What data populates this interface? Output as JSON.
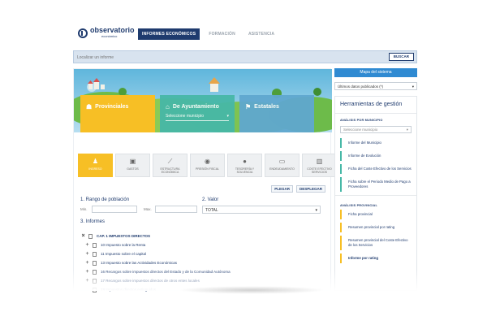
{
  "header": {
    "logo_title": "observatorio",
    "logo_sub": "económico",
    "nav": [
      {
        "label": "INFORMES ECONÓMICOS",
        "active": true
      },
      {
        "label": "FORMACIÓN",
        "active": false
      },
      {
        "label": "ASISTENCIA",
        "active": false
      }
    ]
  },
  "search": {
    "placeholder": "Localizar un informe",
    "button": "BUSCAR"
  },
  "tiles": [
    {
      "title": "Provinciales",
      "icon": "people-icon",
      "select": ""
    },
    {
      "title": "De Ayuntamiento",
      "icon": "bank-icon",
      "select": "Seleccione municipio"
    },
    {
      "title": "Estatales",
      "icon": "flag-icon",
      "select": ""
    }
  ],
  "categories": [
    {
      "label": "INGRESO",
      "icon": "person-icon",
      "active": true
    },
    {
      "label": "GASTOS",
      "icon": "gift-icon",
      "active": false
    },
    {
      "label": "ESTRUCTURA ECONÓMICA",
      "icon": "chart-line-icon",
      "active": false
    },
    {
      "label": "PRESIÓN FISCAL",
      "icon": "gauge-icon",
      "active": false
    },
    {
      "label": "TESORERÍA Y SOLVENCIA",
      "icon": "moneybag-icon",
      "active": false
    },
    {
      "label": "ENDEUDAMIENTO",
      "icon": "card-icon",
      "active": false
    },
    {
      "label": "COSTE EFECTIVO SERVICIOS",
      "icon": "trash-icon",
      "active": false
    }
  ],
  "fold": {
    "collapse": "PLEGAR",
    "expand": "DESPLEGAR"
  },
  "filters": {
    "range_label": "1. Rango de población",
    "min_label": "Min.",
    "max_label": "Max.",
    "value_label": "2. Valor",
    "value_selected": "TOTAL",
    "reports_label": "3. Informes"
  },
  "tree": {
    "root": "CAP. 1 IMPUESTOS DIRECTOS",
    "items": [
      "10 Impuesto sobre la Renta",
      "11 Impuesto sobre el capital",
      "13 Impuesto sobre las Actividades Económicas",
      "16 Recargos sobre impuestos directos del Estado y de la Comunidad Autónoma",
      "17 Recargos sobre impuestos directos de otros entes locales",
      "18 Impuestos directos extinguidos"
    ]
  },
  "right": {
    "map_button": "Mapa del sistema",
    "latest": "Últimos datos publicados (*)",
    "tools_title": "Herramientas de gestión",
    "municipal_section": "ANÁLISIS POR MUNICIPIO",
    "municipio_placeholder": "Seleccione municipio",
    "municipal_items": [
      "Informe del Municipio",
      "Informe de Evolución",
      "Ficha del Coste Efectivo de los Servicios",
      "Ficha sobre el Periodo Medio de Pago a Proveedores"
    ],
    "provincial_section": "ANÁLISIS PROVINCIAL",
    "provincial_items": [
      "Ficha provincial",
      "Resumen provincial por rating",
      "Resumen provincial del Coste Efectivo de los Servicios",
      "Informe por rating"
    ]
  }
}
